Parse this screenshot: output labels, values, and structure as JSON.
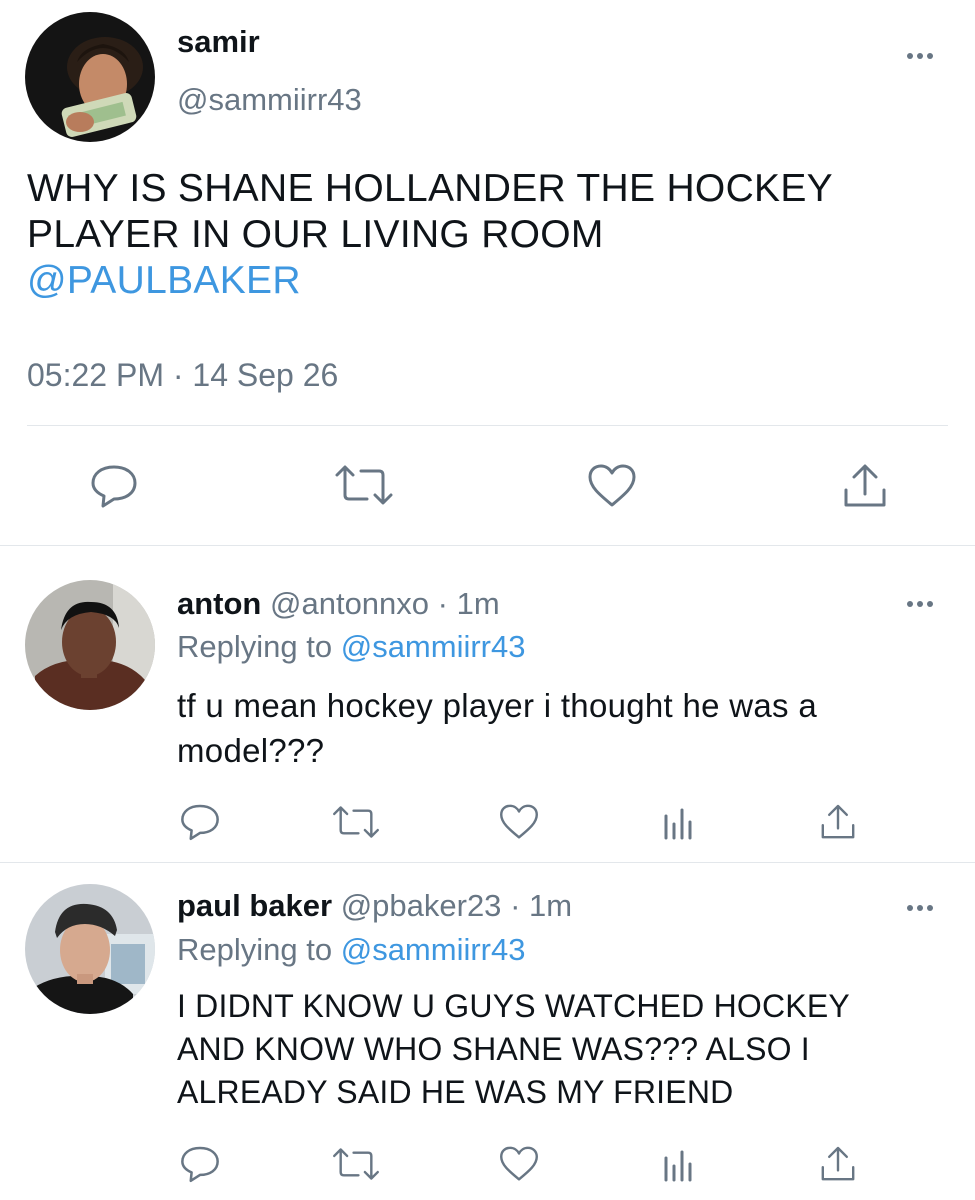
{
  "main_tweet": {
    "display_name": "samir",
    "handle": "@sammiirr43",
    "text": "WHY IS SHANE HOLLANDER THE HOCKEY PLAYER IN OUR LIVING ROOM",
    "mention": "@PAULBAKER",
    "time": "05:22 PM",
    "separator": "·",
    "date": "14 Sep 26",
    "icons": [
      "reply-icon",
      "retweet-icon",
      "like-icon",
      "share-icon"
    ]
  },
  "replies": [
    {
      "display_name": "anton",
      "handle": "@antonnxo",
      "separator": "·",
      "age": "1m",
      "replying_prefix": "Replying to",
      "replying_to": "@sammiirr43",
      "text_lines": [
        "tf u mean hockey player i thought he was a",
        "model???"
      ],
      "icons": [
        "reply-icon",
        "retweet-icon",
        "like-icon",
        "analytics-icon",
        "share-icon"
      ]
    },
    {
      "display_name": "paul baker",
      "handle": "@pbaker23",
      "separator": "·",
      "age": "1m",
      "replying_prefix": "Replying to",
      "replying_to": "@sammiirr43",
      "text_lines": [
        "I DIDNT KNOW U GUYS WATCHED HOCKEY",
        "AND KNOW WHO SHANE WAS??? ALSO I",
        "ALREADY SAID HE WAS MY FRIEND"
      ],
      "icons": [
        "reply-icon",
        "retweet-icon",
        "like-icon",
        "analytics-icon",
        "share-icon"
      ]
    }
  ],
  "colors": {
    "text": "#0f1419",
    "secondary": "#687684",
    "link": "#3e97e0",
    "divider": "#e3e7eb"
  }
}
